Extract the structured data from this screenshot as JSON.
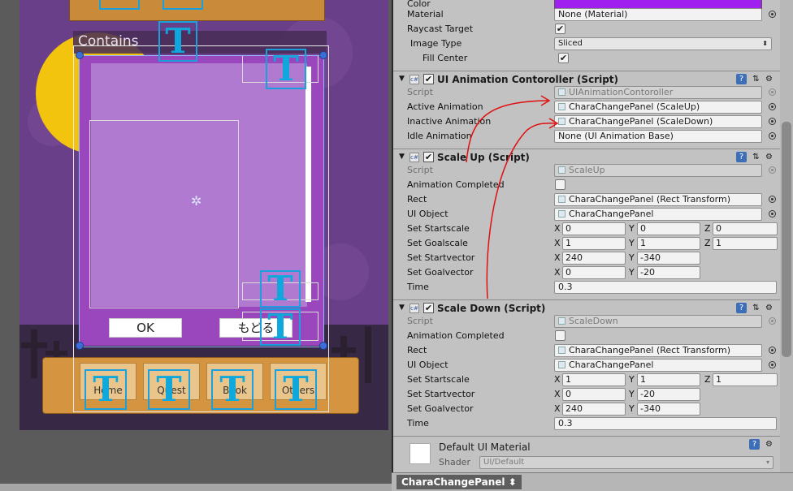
{
  "scene": {
    "contains_label": "Contains",
    "ok_label": "OK",
    "back_label": "もどる",
    "tabs": [
      "Home",
      "Quest",
      "Book",
      "Others"
    ],
    "t_icon_glyph": "T",
    "pivot_glyph": "✲"
  },
  "inspector": {
    "image_component": {
      "rows": [
        {
          "label": "Color",
          "type": "color",
          "value": "",
          "color": "#a020f0"
        },
        {
          "label": "Material",
          "type": "object",
          "value": "None (Material)"
        },
        {
          "label": "Raycast Target",
          "type": "checkbox",
          "checked": true
        },
        {
          "label": "Image Type",
          "type": "select",
          "value": "Sliced"
        },
        {
          "label": "Fill Center",
          "type": "checkbox",
          "checked": true
        }
      ]
    },
    "ui_animation": {
      "title": "UI Animation Contoroller (Script)",
      "rows": [
        {
          "label": "Script",
          "value": "UIAnimationContoroller",
          "dim": true
        },
        {
          "label": "Active Animation",
          "value": "CharaChangePanel (ScaleUp)"
        },
        {
          "label": "Inactive Animation",
          "value": "CharaChangePanel (ScaleDown)"
        },
        {
          "label": "Idle Animation",
          "value": "None (UI Animation Base)"
        }
      ]
    },
    "scale_up": {
      "title": "Scale Up (Script)",
      "script": "ScaleUp",
      "animation_completed_label": "Animation Completed",
      "rect_label": "Rect",
      "rect_value": "CharaChangePanel (Rect Transform)",
      "ui_object_label": "UI Object",
      "ui_object_value": "CharaChangePanel",
      "start_scale_label": "Set Startscale",
      "start_scale": [
        "0",
        "0",
        "0"
      ],
      "goal_scale_label": "Set Goalscale",
      "goal_scale": [
        "1",
        "1",
        "1"
      ],
      "start_vector_label": "Set Startvector",
      "start_vector": [
        "240",
        "-340"
      ],
      "goal_vector_label": "Set Goalvector",
      "goal_vector": [
        "0",
        "-20"
      ],
      "time_label": "Time",
      "time": "0.3"
    },
    "scale_down": {
      "title": "Scale Down (Script)",
      "script": "ScaleDown",
      "animation_completed_label": "Animation Completed",
      "rect_label": "Rect",
      "rect_value": "CharaChangePanel (Rect Transform)",
      "ui_object_label": "UI Object",
      "ui_object_value": "CharaChangePanel",
      "start_scale_label": "Set Startscale",
      "start_scale": [
        "1",
        "1",
        "1"
      ],
      "start_vector_label": "Set Startvector",
      "start_vector": [
        "0",
        "-20"
      ],
      "goal_vector_label": "Set Goalvector",
      "goal_vector": [
        "240",
        "-340"
      ],
      "time_label": "Time",
      "time": "0.3"
    },
    "script_label": "Script",
    "axis": [
      "X",
      "Y",
      "Z"
    ],
    "material": {
      "title": "Default UI Material",
      "shader_label": "Shader",
      "shader_value": "UI/Default"
    },
    "bottom_title": "CharaChangePanel",
    "annotation_color": "#e01010"
  }
}
